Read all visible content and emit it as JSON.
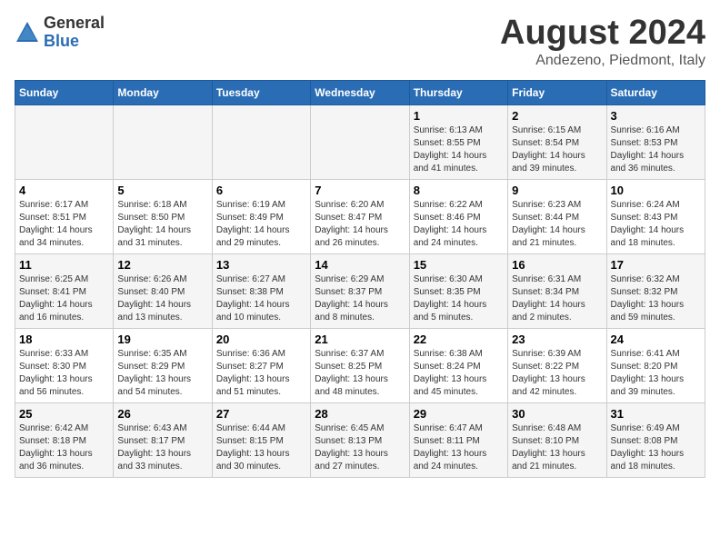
{
  "logo": {
    "general": "General",
    "blue": "Blue"
  },
  "title": "August 2024",
  "subtitle": "Andezeno, Piedmont, Italy",
  "weekdays": [
    "Sunday",
    "Monday",
    "Tuesday",
    "Wednesday",
    "Thursday",
    "Friday",
    "Saturday"
  ],
  "weeks": [
    [
      {
        "day": "",
        "info": ""
      },
      {
        "day": "",
        "info": ""
      },
      {
        "day": "",
        "info": ""
      },
      {
        "day": "",
        "info": ""
      },
      {
        "day": "1",
        "info": "Sunrise: 6:13 AM\nSunset: 8:55 PM\nDaylight: 14 hours and 41 minutes."
      },
      {
        "day": "2",
        "info": "Sunrise: 6:15 AM\nSunset: 8:54 PM\nDaylight: 14 hours and 39 minutes."
      },
      {
        "day": "3",
        "info": "Sunrise: 6:16 AM\nSunset: 8:53 PM\nDaylight: 14 hours and 36 minutes."
      }
    ],
    [
      {
        "day": "4",
        "info": "Sunrise: 6:17 AM\nSunset: 8:51 PM\nDaylight: 14 hours and 34 minutes."
      },
      {
        "day": "5",
        "info": "Sunrise: 6:18 AM\nSunset: 8:50 PM\nDaylight: 14 hours and 31 minutes."
      },
      {
        "day": "6",
        "info": "Sunrise: 6:19 AM\nSunset: 8:49 PM\nDaylight: 14 hours and 29 minutes."
      },
      {
        "day": "7",
        "info": "Sunrise: 6:20 AM\nSunset: 8:47 PM\nDaylight: 14 hours and 26 minutes."
      },
      {
        "day": "8",
        "info": "Sunrise: 6:22 AM\nSunset: 8:46 PM\nDaylight: 14 hours and 24 minutes."
      },
      {
        "day": "9",
        "info": "Sunrise: 6:23 AM\nSunset: 8:44 PM\nDaylight: 14 hours and 21 minutes."
      },
      {
        "day": "10",
        "info": "Sunrise: 6:24 AM\nSunset: 8:43 PM\nDaylight: 14 hours and 18 minutes."
      }
    ],
    [
      {
        "day": "11",
        "info": "Sunrise: 6:25 AM\nSunset: 8:41 PM\nDaylight: 14 hours and 16 minutes."
      },
      {
        "day": "12",
        "info": "Sunrise: 6:26 AM\nSunset: 8:40 PM\nDaylight: 14 hours and 13 minutes."
      },
      {
        "day": "13",
        "info": "Sunrise: 6:27 AM\nSunset: 8:38 PM\nDaylight: 14 hours and 10 minutes."
      },
      {
        "day": "14",
        "info": "Sunrise: 6:29 AM\nSunset: 8:37 PM\nDaylight: 14 hours and 8 minutes."
      },
      {
        "day": "15",
        "info": "Sunrise: 6:30 AM\nSunset: 8:35 PM\nDaylight: 14 hours and 5 minutes."
      },
      {
        "day": "16",
        "info": "Sunrise: 6:31 AM\nSunset: 8:34 PM\nDaylight: 14 hours and 2 minutes."
      },
      {
        "day": "17",
        "info": "Sunrise: 6:32 AM\nSunset: 8:32 PM\nDaylight: 13 hours and 59 minutes."
      }
    ],
    [
      {
        "day": "18",
        "info": "Sunrise: 6:33 AM\nSunset: 8:30 PM\nDaylight: 13 hours and 56 minutes."
      },
      {
        "day": "19",
        "info": "Sunrise: 6:35 AM\nSunset: 8:29 PM\nDaylight: 13 hours and 54 minutes."
      },
      {
        "day": "20",
        "info": "Sunrise: 6:36 AM\nSunset: 8:27 PM\nDaylight: 13 hours and 51 minutes."
      },
      {
        "day": "21",
        "info": "Sunrise: 6:37 AM\nSunset: 8:25 PM\nDaylight: 13 hours and 48 minutes."
      },
      {
        "day": "22",
        "info": "Sunrise: 6:38 AM\nSunset: 8:24 PM\nDaylight: 13 hours and 45 minutes."
      },
      {
        "day": "23",
        "info": "Sunrise: 6:39 AM\nSunset: 8:22 PM\nDaylight: 13 hours and 42 minutes."
      },
      {
        "day": "24",
        "info": "Sunrise: 6:41 AM\nSunset: 8:20 PM\nDaylight: 13 hours and 39 minutes."
      }
    ],
    [
      {
        "day": "25",
        "info": "Sunrise: 6:42 AM\nSunset: 8:18 PM\nDaylight: 13 hours and 36 minutes."
      },
      {
        "day": "26",
        "info": "Sunrise: 6:43 AM\nSunset: 8:17 PM\nDaylight: 13 hours and 33 minutes."
      },
      {
        "day": "27",
        "info": "Sunrise: 6:44 AM\nSunset: 8:15 PM\nDaylight: 13 hours and 30 minutes."
      },
      {
        "day": "28",
        "info": "Sunrise: 6:45 AM\nSunset: 8:13 PM\nDaylight: 13 hours and 27 minutes."
      },
      {
        "day": "29",
        "info": "Sunrise: 6:47 AM\nSunset: 8:11 PM\nDaylight: 13 hours and 24 minutes."
      },
      {
        "day": "30",
        "info": "Sunrise: 6:48 AM\nSunset: 8:10 PM\nDaylight: 13 hours and 21 minutes."
      },
      {
        "day": "31",
        "info": "Sunrise: 6:49 AM\nSunset: 8:08 PM\nDaylight: 13 hours and 18 minutes."
      }
    ]
  ]
}
